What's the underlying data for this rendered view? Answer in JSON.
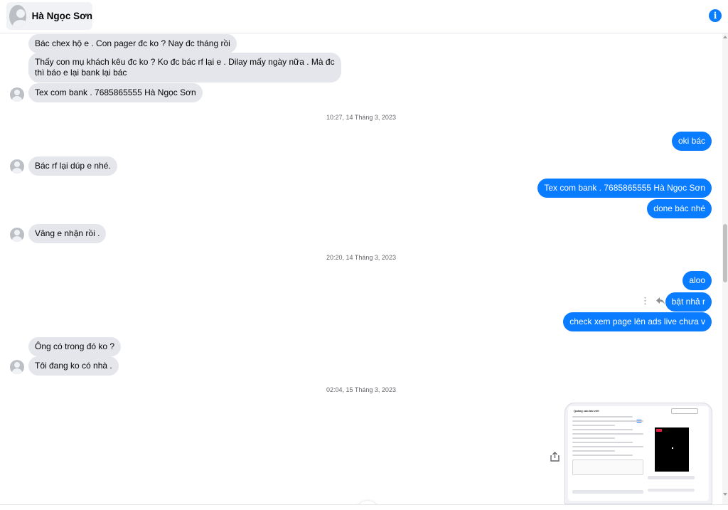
{
  "header": {
    "contact_name": "Hà Ngọc Sơn",
    "info_icon": "info-icon",
    "info_glyph": "i",
    "accent_color": "#0a7cff"
  },
  "messages": [
    {
      "side": "in",
      "text": "Bác chex hộ e . Con pager đc ko ? Nay đc tháng rồi"
    },
    {
      "side": "in",
      "text": "Thấy con mụ khách kêu đc ko ? Ko đc bác rf lại e . Dilay mấy ngày nữa . Mà đc thì báo e lại bank lại bác"
    },
    {
      "side": "in",
      "text": "Tex com bank . 7685865555  Hà Ngọc Sơn"
    },
    {
      "side": "timestamp",
      "text": "10:27, 14 Tháng 3, 2023"
    },
    {
      "side": "out",
      "text": "oki bác"
    },
    {
      "side": "in",
      "text": "Bác rf lại dúp e nhé."
    },
    {
      "side": "out",
      "text": "Tex com bank . 7685865555  Hà Ngọc Sơn"
    },
    {
      "side": "out",
      "text": "done bác nhé"
    },
    {
      "side": "in",
      "text": "Vâng e nhận rồi ."
    },
    {
      "side": "timestamp",
      "text": "20:20, 14 Tháng 3, 2023"
    },
    {
      "side": "out",
      "text": "aloo"
    },
    {
      "side": "out",
      "text": "bật nhả r"
    },
    {
      "side": "out",
      "text": "check xem page lên ads live chưa v"
    },
    {
      "side": "in",
      "text": "Ông có trong đó ko ?"
    },
    {
      "side": "in",
      "text": "Tôi đang ko có nhà ."
    },
    {
      "side": "timestamp",
      "text": "02:04, 15 Tháng 3, 2023"
    }
  ],
  "attachment": {
    "type": "image",
    "inner_title": "Quảng cáo bài viết"
  },
  "icons": {
    "avatar": "avatar-icon",
    "more": "more-icon",
    "reply": "reply-icon",
    "share": "share-icon",
    "scroll_down": "arrow-down-icon"
  },
  "glyphs": {
    "more": "⋮"
  },
  "colors": {
    "incoming_bubble": "#e4e6eb",
    "outgoing_bubble": "#0a7cff",
    "timestamp": "#65676b"
  }
}
